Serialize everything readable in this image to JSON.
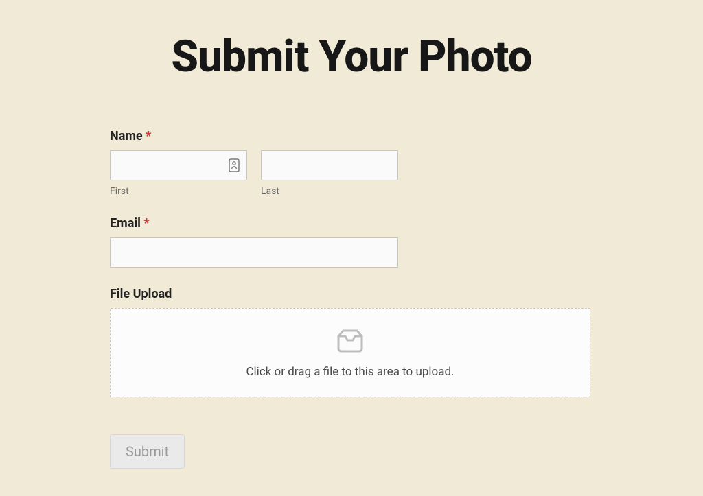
{
  "header": {
    "title": "Submit Your Photo"
  },
  "form": {
    "name": {
      "label": "Name",
      "required_marker": "*",
      "first": {
        "sublabel": "First",
        "value": ""
      },
      "last": {
        "sublabel": "Last",
        "value": ""
      }
    },
    "email": {
      "label": "Email",
      "required_marker": "*",
      "value": ""
    },
    "upload": {
      "label": "File Upload",
      "hint": "Click or drag a file to this area to upload."
    },
    "submit_label": "Submit"
  },
  "icons": {
    "contact_card": "contact-card-icon",
    "inbox": "inbox-icon"
  }
}
